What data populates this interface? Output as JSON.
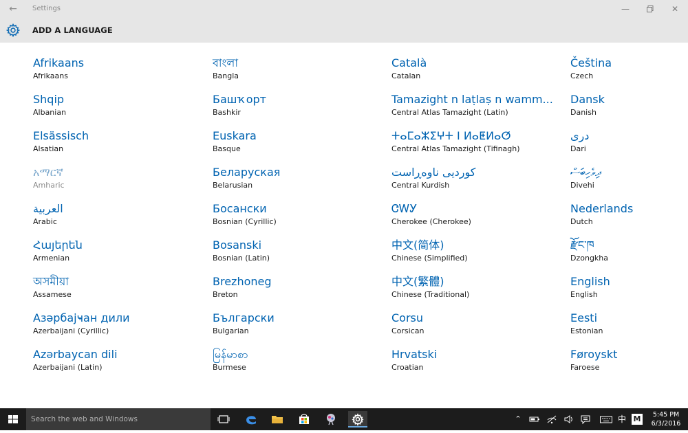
{
  "window": {
    "title": "Settings"
  },
  "header": {
    "title": "ADD A LANGUAGE"
  },
  "languages": [
    [
      {
        "native": "Afrikaans",
        "english": "Afrikaans"
      },
      {
        "native": "Shqip",
        "english": "Albanian"
      },
      {
        "native": "Elsässisch",
        "english": "Alsatian"
      },
      {
        "native": "አማርኛ",
        "english": "Amharic"
      },
      {
        "native": "العربية",
        "english": "Arabic"
      },
      {
        "native": "Հայերեն",
        "english": "Armenian"
      },
      {
        "native": "অসমীয়া",
        "english": "Assamese"
      },
      {
        "native": "Азәрбајҹан дили",
        "english": "Azerbaijani (Cyrillic)"
      },
      {
        "native": "Azərbaycan dili",
        "english": "Azerbaijani (Latin)"
      }
    ],
    [
      {
        "native": "বাংলা",
        "english": "Bangla"
      },
      {
        "native": "Башҡорт",
        "english": "Bashkir"
      },
      {
        "native": "Euskara",
        "english": "Basque"
      },
      {
        "native": "Беларуская",
        "english": "Belarusian"
      },
      {
        "native": "Босански",
        "english": "Bosnian (Cyrillic)"
      },
      {
        "native": "Bosanski",
        "english": "Bosnian (Latin)"
      },
      {
        "native": "Brezhoneg",
        "english": "Breton"
      },
      {
        "native": "Български",
        "english": "Bulgarian"
      },
      {
        "native": "မြန်မာစာ",
        "english": "Burmese"
      }
    ],
    [
      {
        "native": "Català",
        "english": "Catalan"
      },
      {
        "native": "Tamazight n laṭlaṣ n wamm...",
        "english": "Central Atlas Tamazight (Latin)"
      },
      {
        "native": "ⵜⴰⵎⴰⵣⵉⵖⵜ ⵏ ⵍⴰⵟⵍⴰⵚ",
        "english": "Central Atlas Tamazight (Tifinagh)"
      },
      {
        "native": "کوردیی ناوەڕاست",
        "english": "Central Kurdish"
      },
      {
        "native": "ᏣᎳᎩ",
        "english": "Cherokee (Cherokee)"
      },
      {
        "native": "中文(简体)",
        "english": "Chinese (Simplified)"
      },
      {
        "native": "中文(繁體)",
        "english": "Chinese (Traditional)"
      },
      {
        "native": "Corsu",
        "english": "Corsican"
      },
      {
        "native": "Hrvatski",
        "english": "Croatian"
      }
    ],
    [
      {
        "native": "Čeština",
        "english": "Czech"
      },
      {
        "native": "Dansk",
        "english": "Danish"
      },
      {
        "native": "دری",
        "english": "Dari"
      },
      {
        "native": "ދިވެހިބަސް",
        "english": "Divehi"
      },
      {
        "native": "Nederlands",
        "english": "Dutch"
      },
      {
        "native": "རྫོང་ཁ",
        "english": "Dzongkha"
      },
      {
        "native": "English",
        "english": "English"
      },
      {
        "native": "Eesti",
        "english": "Estonian"
      },
      {
        "native": "Føroyskt",
        "english": "Faroese"
      }
    ]
  ],
  "taskbar": {
    "search_placeholder": "Search the web and Windows",
    "lang_indicator": "中",
    "ime_indicator": "M",
    "time": "5:45 PM",
    "date": "6/3/2016"
  },
  "colors": {
    "accent": "#0063b1",
    "chrome": "#e6e6e6",
    "taskbar": "#1c1c1c"
  }
}
